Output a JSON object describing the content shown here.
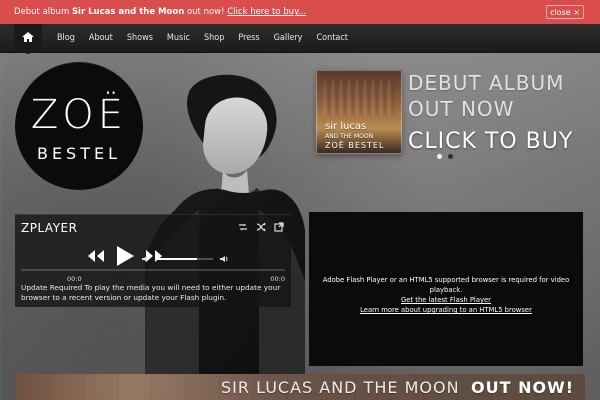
{
  "notice": {
    "prefix": "Debut album ",
    "album": "Sir Lucas and the Moon",
    "suffix": " out now! ",
    "link": "Click here to buy...",
    "close_label": "close"
  },
  "nav": {
    "items": [
      "Blog",
      "About",
      "Shows",
      "Music",
      "Shop",
      "Press",
      "Gallery",
      "Contact"
    ]
  },
  "logo": {
    "line1": "ZOË",
    "line2": "BESTEL"
  },
  "album_art": {
    "line1": "sir lucas",
    "line2": "AND THE MOON",
    "line3": "ZOË BESTEL"
  },
  "promo": {
    "line1": "DEBUT ALBUM",
    "line2": "OUT NOW",
    "cta": "CLICK TO BUY"
  },
  "player": {
    "title": "ZPLAYER",
    "time_left": "00:0",
    "time_right": "00:0",
    "progress_fraction": 0.0,
    "volume_fraction": 0.72,
    "message": "Update Required To play the media you will need to either update your browser to a recent version or update your Flash plugin."
  },
  "video": {
    "line1": "Adobe Flash Player or an HTML5 supported browser is required for video playback.",
    "link1": "Get the latest Flash Player",
    "link2": "Learn more about upgrading to an HTML5 browser"
  },
  "banner": {
    "left": "SIR LUCAS AND THE MOON",
    "right": "OUT NOW!"
  },
  "colors": {
    "accent": "#d94d4d"
  }
}
